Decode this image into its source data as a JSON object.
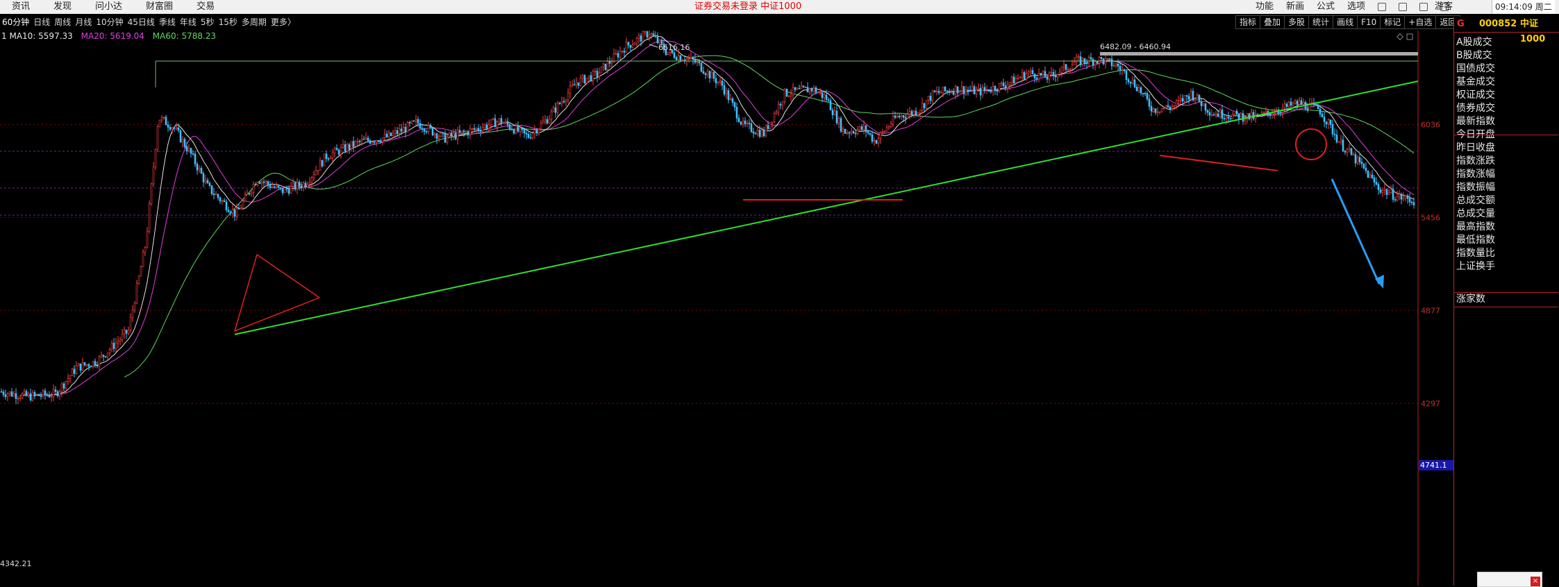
{
  "topbar": {
    "menu": [
      "资讯",
      "发现",
      "问小达",
      "财富圈",
      "交易"
    ],
    "notice": "证券交易未登录  中证1000",
    "right_menu": [
      "功能",
      "新画",
      "公式",
      "选项"
    ],
    "guest": "游客",
    "clock": "09:14:09 周二"
  },
  "periods": [
    "60分钟",
    "日线",
    "周线",
    "月线",
    "10分钟",
    "45日线",
    "季线",
    "年线",
    "5秒",
    "15秒",
    "多周期",
    "更多〉"
  ],
  "chart_buttons": [
    "指标",
    "叠加",
    "多股",
    "统计",
    "画线",
    "F10",
    "标记",
    "+自选",
    "返回"
  ],
  "legend": {
    "prefix": "1",
    "ma10": "MA10: 5597.33",
    "ma20": "MA20: 5619.04",
    "ma60": "MA60: 5788.23"
  },
  "panel": {
    "flag": "G",
    "code": "000852",
    "name": "中证1000",
    "rows": [
      "A股成交",
      "B股成交",
      "国债成交",
      "基金成交",
      "权证成交",
      "债券成交",
      "最新指数",
      "今日开盘",
      "昨日收盘",
      "指数涨跌",
      "指数涨幅",
      "指数振幅",
      "总成交额",
      "总成交量",
      "最高指数",
      "最低指数",
      "指数量比",
      "上证换手"
    ],
    "last_row": "涨家数"
  },
  "price_tag": "4741.1",
  "chart_data": {
    "type": "candlestick",
    "symbol": "000852",
    "name": "中证1000",
    "y_ticks": [
      6036,
      5456,
      4877,
      4297
    ],
    "ylim": [
      4297,
      6700
    ],
    "annotations": {
      "high": "6616.16",
      "range": "6482.09 - 6460.94",
      "low": "4342.21"
    },
    "ma_colors": {
      "ma10": "#e6e6e6",
      "ma20": "#e040e0",
      "ma60": "#60d860"
    },
    "up_color": "#ff4040",
    "down_color": "#40c0ff"
  }
}
